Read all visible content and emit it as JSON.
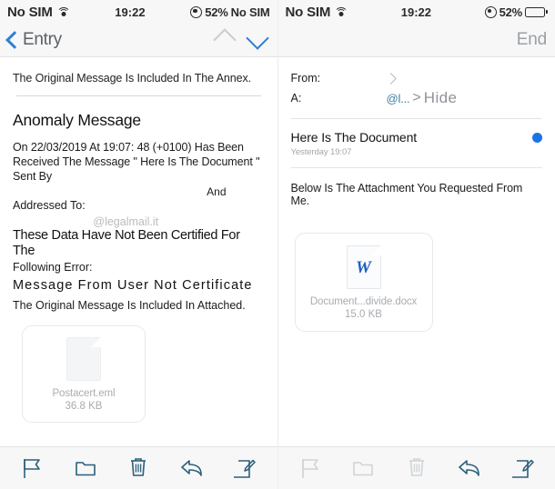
{
  "left": {
    "status": {
      "carrier": "No SIM",
      "wifi_icon": "wifi-icon",
      "time": "19:22",
      "location_icon": "location-icon",
      "battery_percent": "52%"
    },
    "nav": {
      "back_label": "Entry",
      "back_icon": "chevron-left-icon",
      "prev_icon": "chevron-up-icon",
      "next_icon": "chevron-down-icon"
    },
    "content": {
      "annex_note": "The Original Message Is Included In The Annex.",
      "title": "Anomaly Message",
      "paragraph": "On 22/03/2019 At 19:07: 48 (+0100) Has Been Received The Message \" Here Is The Document \" Sent By",
      "and_text": "And",
      "addressed_to": "Addressed To:",
      "watermark": "@legalmail.it",
      "cert_line": "These Data Have Not Been Certified For The",
      "following_error": "Following Error:",
      "error_text": "Message From User Not Certificate",
      "tail_text": "The Original Message Is Included In Attached."
    },
    "attachment": {
      "icon": "generic-file-icon",
      "name": "Postacert.eml",
      "size": "36.8 KB"
    },
    "toolbar": [
      {
        "name": "flag-icon",
        "label": "Flag",
        "dim": false
      },
      {
        "name": "folder-icon",
        "label": "Move to folder",
        "dim": false
      },
      {
        "name": "trash-icon",
        "label": "Delete",
        "dim": false
      },
      {
        "name": "reply-icon",
        "label": "Reply",
        "dim": false
      },
      {
        "name": "compose-icon",
        "label": "Compose",
        "dim": false
      }
    ]
  },
  "right": {
    "status": {
      "carrier": "No SIM",
      "wifi_icon": "wifi-icon",
      "time": "19:22",
      "location_icon": "location-icon",
      "battery_percent": "52%"
    },
    "nav": {
      "end_label": "End"
    },
    "meta": {
      "from_label": "From:",
      "from_detail_icon": "chevron-right-icon",
      "to_label": "A:",
      "to_value": "@l...",
      "to_separator": ">",
      "hide_label": "Hide"
    },
    "message": {
      "subject": "Here Is The Document",
      "date": "Yesterday 19:07",
      "unread_dot": "unread-dot",
      "body": "Below Is The Attachment You Requested From Me."
    },
    "attachment": {
      "icon": "word-document-icon",
      "icon_glyph": "W",
      "name": "Document...divide.docx",
      "size": "15.0 KB"
    },
    "toolbar": [
      {
        "name": "flag-icon",
        "label": "Flag",
        "dim": true
      },
      {
        "name": "folder-icon",
        "label": "Move to folder",
        "dim": true
      },
      {
        "name": "trash-icon",
        "label": "Delete",
        "dim": true
      },
      {
        "name": "reply-icon",
        "label": "Reply",
        "dim": false
      },
      {
        "name": "compose-icon",
        "label": "Compose",
        "dim": false
      }
    ]
  },
  "colors": {
    "accent_blue": "#2c7fd6",
    "unread_blue": "#1b74e4",
    "toolbar_icon": "#2c5f7a",
    "toolbar_icon_dim": "#cfd4d8",
    "word_blue": "#1f5fbf"
  }
}
